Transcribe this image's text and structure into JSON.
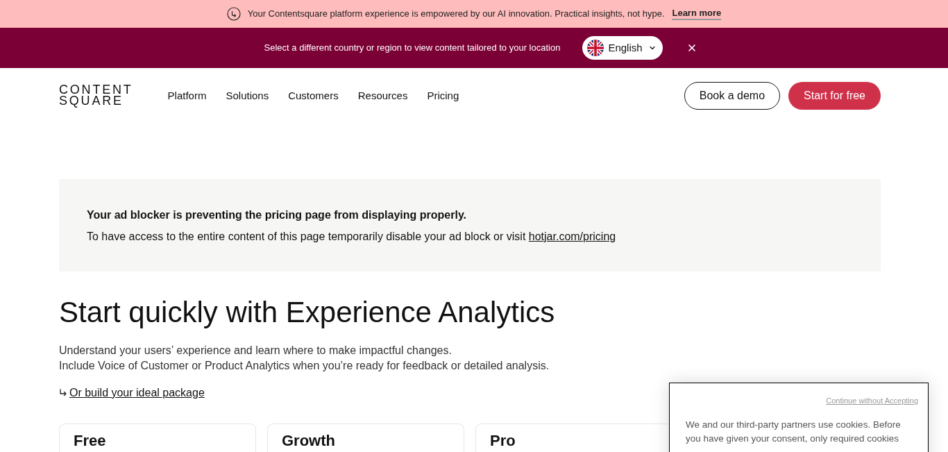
{
  "announcement": {
    "text": "Your Contentsquare platform experience is empowered by our AI innovation. Practical insights, not hype.",
    "link": "Learn more"
  },
  "region_bar": {
    "text": "Select a different country or region to view content tailored to your location",
    "language": "English"
  },
  "nav": {
    "logo": [
      "CONTENT",
      "SQUARE"
    ],
    "items": [
      "Platform",
      "Solutions",
      "Customers",
      "Resources",
      "Pricing"
    ],
    "buttons": [
      {
        "label": "Book a demo",
        "kind": "outline"
      },
      {
        "label": "Start for free",
        "kind": "primary"
      }
    ]
  },
  "notice": {
    "title": "Your ad blocker is preventing the pricing page from displaying properly.",
    "text": "To have access to the entire content of this page temporarily disable your ad block or visit",
    "link": "hotjar.com/pricing"
  },
  "hero": {
    "heading": "Start quickly with Experience Analytics",
    "lines": [
      "Understand your users’ experience and learn where to make impactful changes.",
      "Include Voice of Customer or Product Analytics when you’re ready for feedback or detailed analysis."
    ],
    "link": "Or build your ideal package"
  },
  "plans": [
    {
      "name": "Free"
    },
    {
      "name": "Growth"
    },
    {
      "name": "Pro"
    }
  ],
  "cookie_banner": {
    "skip_link": "Continue without Accepting",
    "text": "We and our third-party partners use cookies. Before you have given your consent, only required cookies"
  }
}
